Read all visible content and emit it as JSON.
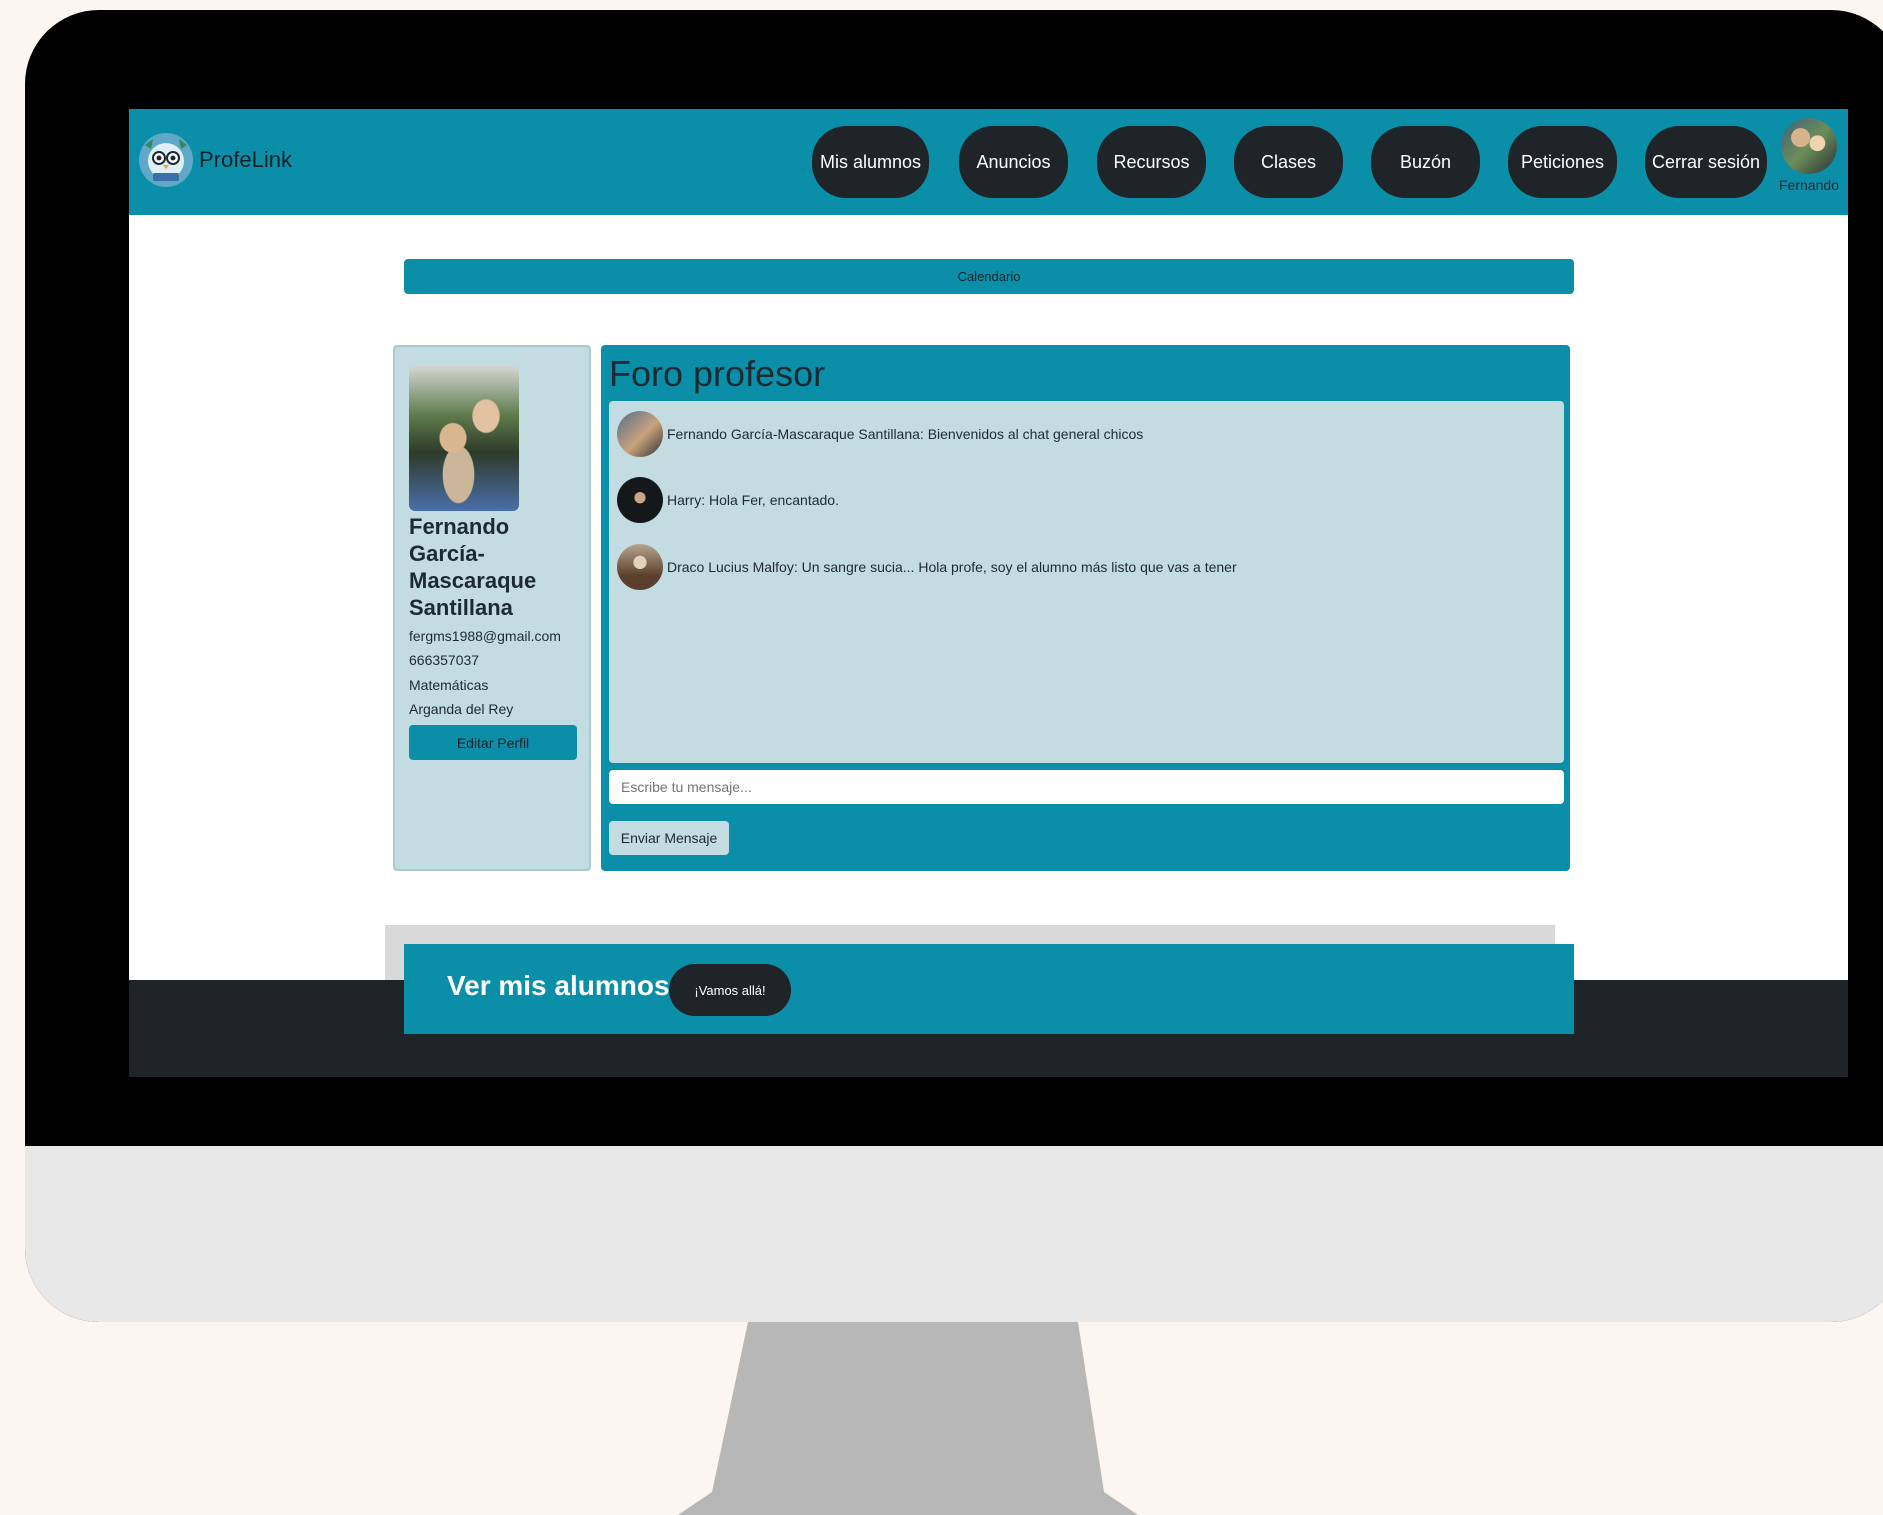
{
  "app": {
    "name": "ProfeLink",
    "logo_icon": "owl-logo-icon"
  },
  "navbar": {
    "items": [
      {
        "label": "Mis alumnos"
      },
      {
        "label": "Anuncios"
      },
      {
        "label": "Recursos"
      },
      {
        "label": "Clases"
      },
      {
        "label": "Buzón"
      },
      {
        "label": "Peticiones"
      },
      {
        "label": "Cerrar sesión"
      }
    ],
    "user_name": "Fernando"
  },
  "calendar": {
    "label": "Calendario"
  },
  "profile": {
    "name": "Fernando García-Mascaraque Santillana",
    "email": "fergms1988@gmail.com",
    "phone": "666357037",
    "subject": "Matemáticas",
    "location": "Arganda del Rey",
    "edit_label": "Editar Perfil"
  },
  "forum": {
    "title": "Foro profesor",
    "messages": [
      {
        "text": "Fernando García-Mascaraque Santillana: Bienvenidos al chat general chicos"
      },
      {
        "text": "Harry: Hola Fer, encantado."
      },
      {
        "text": "Draco Lucius Malfoy: Un sangre sucia... Hola profe, soy el alumno más listo que vas a tener"
      }
    ],
    "input_placeholder": "Escribe tu mensaje...",
    "send_label": "Enviar Mensaje"
  },
  "students_section": {
    "title": "Ver mis alumnos",
    "button_label": "¡Vamos allá!"
  },
  "colors": {
    "primary": "#0b8fa8",
    "dark": "#1f2429",
    "panel": "#c3dce1"
  }
}
